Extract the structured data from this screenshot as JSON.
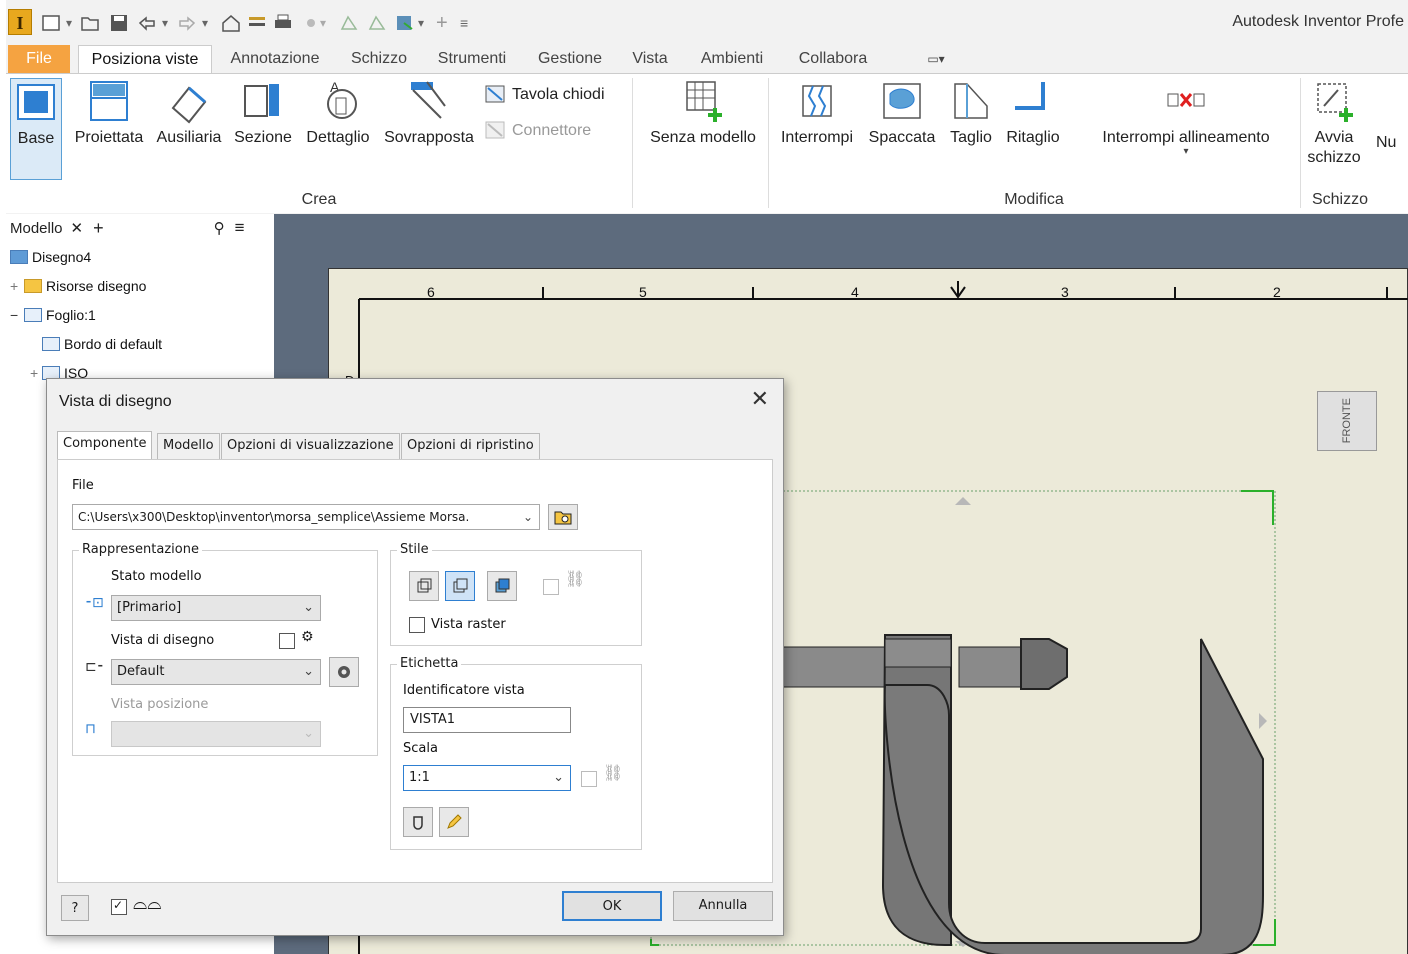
{
  "app": {
    "title": "Autodesk Inventor Profe",
    "logo": "I"
  },
  "qat": {
    "icons": [
      "new-icon",
      "open-icon",
      "save-icon",
      "undo-icon",
      "redo-icon",
      "home-icon",
      "grid-icon",
      "print-icon",
      "measure-icon",
      "project-icon",
      "update-icon",
      "material-icon",
      "plus-icon",
      "customize-icon"
    ]
  },
  "tabs": [
    {
      "label": "File"
    },
    {
      "label": "Posiziona viste"
    },
    {
      "label": "Annotazione"
    },
    {
      "label": "Schizzo"
    },
    {
      "label": "Strumenti"
    },
    {
      "label": "Gestione"
    },
    {
      "label": "Vista"
    },
    {
      "label": "Ambienti"
    },
    {
      "label": "Collabora"
    }
  ],
  "ribbon": {
    "crea": {
      "group_label": "Crea",
      "buttons": [
        "Base",
        "Proiettata",
        "Ausiliaria",
        "Sezione",
        "Dettaglio",
        "Sovrapposta"
      ],
      "small": [
        "Tavola chiodi",
        "Connettore"
      ]
    },
    "senza_modello": "Senza modello",
    "modifica": {
      "group_label": "Modifica",
      "buttons": [
        "Interrompi",
        "Spaccata",
        "Taglio",
        "Ritaglio",
        "Interrompi allineamento"
      ]
    },
    "schizzo": {
      "group_label": "Schizzo",
      "avvia_line1": "Avvia",
      "avvia_line2": "schizzo",
      "nu": "Nu"
    }
  },
  "browser": {
    "tab_label": "Modello",
    "items": [
      {
        "label": "Disegno4"
      },
      {
        "label": "Risorse disegno"
      },
      {
        "label": "Foglio:1"
      },
      {
        "label": "Bordo di default"
      },
      {
        "label": "ISO"
      }
    ]
  },
  "sheet": {
    "ruler_numbers": [
      "6",
      "5",
      "4",
      "3",
      "2"
    ],
    "letter_d": "D",
    "viewcube_label": "FRONTE"
  },
  "dialog": {
    "title": "Vista di disegno",
    "tabs": [
      "Componente",
      "Modello",
      "Opzioni di visualizzazione",
      "Opzioni di ripristino"
    ],
    "file_label": "File",
    "file_value": "C:\\Users\\x300\\Desktop\\inventor\\morsa_semplice\\Assieme Morsa.",
    "rappresentazione": {
      "legend": "Rappresentazione",
      "stato_modello_label": "Stato modello",
      "stato_modello_value": "[Primario]",
      "vista_disegno_label": "Vista di disegno",
      "vista_disegno_value": "Default",
      "vista_posizione_label": "Vista posizione"
    },
    "stile": {
      "legend": "Stile",
      "vista_raster": "Vista raster"
    },
    "etichetta": {
      "legend": "Etichetta",
      "identificatore_label": "Identificatore vista",
      "identificatore_value": "VISTA1",
      "scala_label": "Scala",
      "scala_value": "1:1"
    },
    "ok": "OK",
    "annulla": "Annulla"
  }
}
